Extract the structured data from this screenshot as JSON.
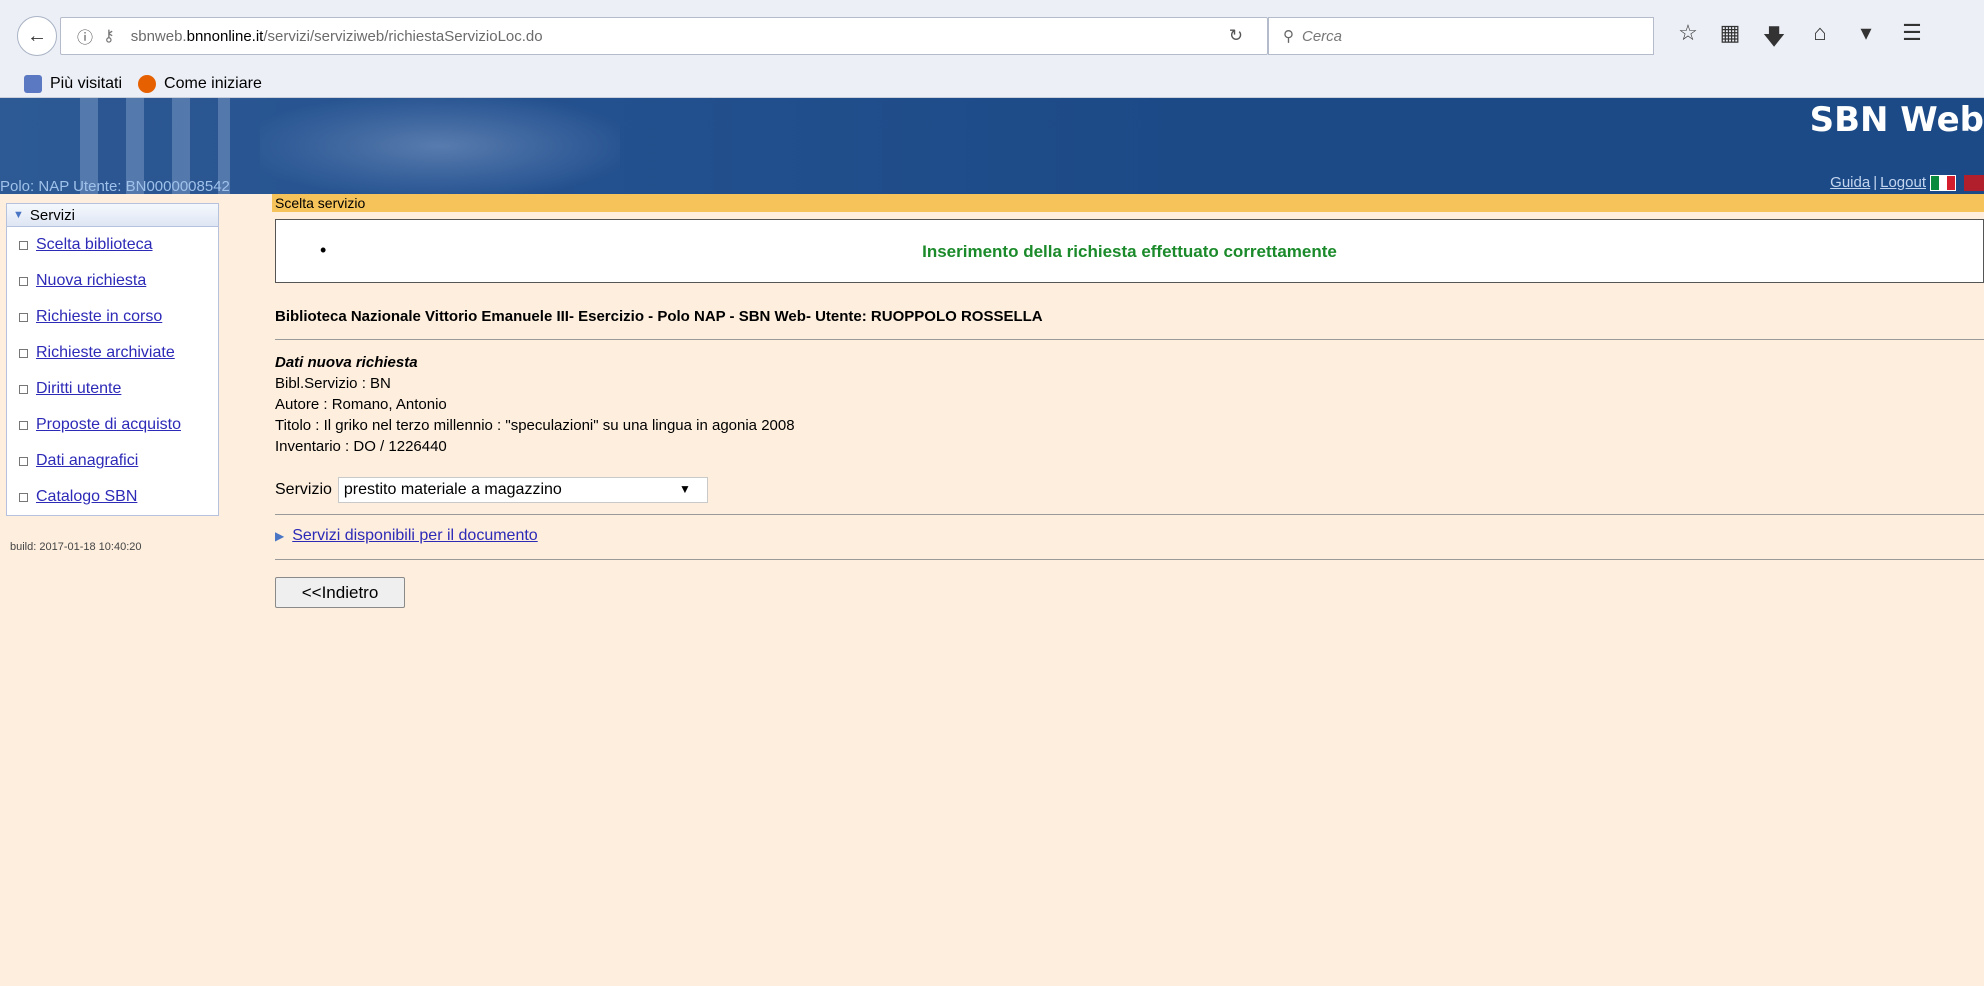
{
  "browser": {
    "url_prefix": "sbnweb.",
    "url_host": "bnnonline.it",
    "url_path": "/servizi/serviziweb/richiestaServizioLoc.do",
    "search_placeholder": "Cerca",
    "bookmarks": [
      "Più visitati",
      "Come iniziare"
    ]
  },
  "header": {
    "title": "SBN Web",
    "polo_line": "Polo: NAP  Utente: BN0000008542",
    "link_guida": "Guida",
    "link_sep": "|",
    "link_logout": "Logout"
  },
  "sidebar": {
    "title": "Servizi",
    "items": [
      {
        "label": "Scelta biblioteca"
      },
      {
        "label": "Nuova richiesta"
      },
      {
        "label": "Richieste in corso"
      },
      {
        "label": "Richieste archiviate"
      },
      {
        "label": "Diritti utente"
      },
      {
        "label": "Proposte di acquisto"
      },
      {
        "label": "Dati anagrafici"
      },
      {
        "label": "Catalogo SBN"
      }
    ],
    "build": "build: 2017-01-18 10:40:20"
  },
  "content": {
    "tab_label": "Scelta servizio",
    "success_message": "Inserimento della richiesta effettuato correttamente",
    "library_line": "Biblioteca Nazionale Vittorio Emanuele III- Esercizio - Polo NAP - SBN Web- Utente: RUOPPOLO ROSSELLA",
    "details_heading": "Dati nuova richiesta",
    "bibl_servizio": "Bibl.Servizio : BN",
    "autore": "Autore : Romano, Antonio",
    "titolo": "Titolo : Il griko nel terzo millennio : \"speculazioni\" su una lingua in agonia 2008",
    "inventario": "Inventario : DO / 1226440",
    "servizio_label": "Servizio",
    "servizio_value": "prestito materiale a magazzino",
    "servizi_disponibili": "Servizi disponibili per il documento",
    "back_button": "<<Indietro"
  },
  "colors": {
    "header_blue": "#1c4a87",
    "tab_yellow": "#f6c35a",
    "page_bg": "#fdeede",
    "success_green": "#1b8a2a",
    "link_blue": "#2d2ab7"
  }
}
